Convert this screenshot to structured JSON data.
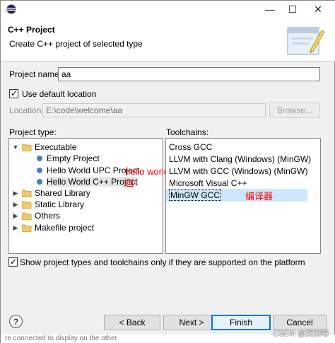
{
  "window": {
    "minimize": "—",
    "maximize": "☐",
    "close": "✕"
  },
  "header": {
    "title": "C++ Project",
    "description": "Create C++ project of selected type"
  },
  "project_name": {
    "label": "Project name:",
    "value": "aa"
  },
  "default_location": {
    "label": "Use default location",
    "checked": true
  },
  "location": {
    "label": "Location:",
    "value": "E:\\code\\welcome\\aa",
    "browse_label": "Browse..."
  },
  "project_type": {
    "label": "Project type:",
    "items": [
      {
        "label": "Executable",
        "level": 0,
        "expanded": true
      },
      {
        "label": "Empty Project",
        "level": 1
      },
      {
        "label": "Hello World UPC Project",
        "level": 1
      },
      {
        "label": "Hello World C++ Project",
        "level": 1,
        "selected": true
      },
      {
        "label": "Shared Library",
        "level": 0,
        "expanded": false
      },
      {
        "label": "Static Library",
        "level": 0,
        "expanded": false
      },
      {
        "label": "Others",
        "level": 0,
        "expanded": false
      },
      {
        "label": "Makefile project",
        "level": 0,
        "expanded": false
      }
    ]
  },
  "toolchains": {
    "label": "Toolchains:",
    "items": [
      "Cross GCC",
      "LLVM with Clang (Windows) (MinGW)",
      "LLVM with GCC (Windows) (MinGW)",
      "Microsoft Visual C++",
      "MinGW GCC"
    ],
    "selected": "MinGW GCC"
  },
  "annotations": {
    "hello_world_line1": "hello world 项",
    "hello_world_line2": "目",
    "compiler": "编译器"
  },
  "filter_checkbox": {
    "label": "Show project types and toolchains only if they are supported on the platform",
    "checked": true
  },
  "buttons": {
    "back": "< Back",
    "next": "Next >",
    "finish": "Finish",
    "cancel": "Cancel"
  },
  "help_icon": "?",
  "bottom_text": "re connected to display on the other",
  "watermark": "CSDN @哭哭啼",
  "colors": {
    "selection": "#cce8ff",
    "default_button_border": "#0078d7",
    "annotation": "#ff0000"
  }
}
